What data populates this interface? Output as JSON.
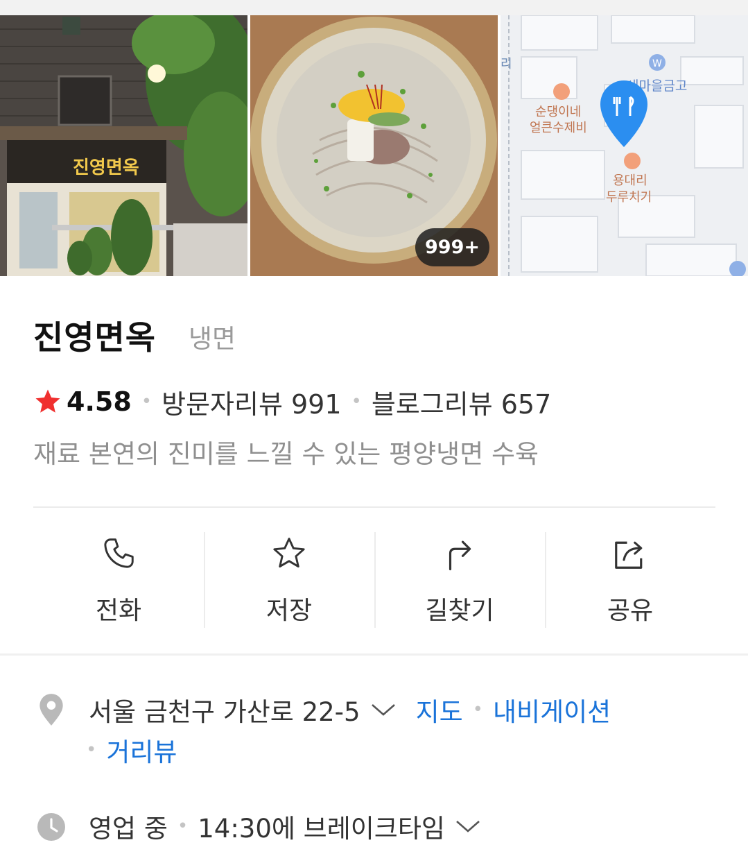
{
  "photos": {
    "storefront_sign": "진영면옥",
    "photo_count_badge": "999+",
    "map_labels": [
      "새마을금고",
      "순댕이네 얼큰수제비",
      "용대리 두루치기",
      "리"
    ]
  },
  "place": {
    "name": "진영면옥",
    "category": "냉면",
    "rating": "4.58",
    "visitor_review_label": "방문자리뷰 991",
    "blog_review_label": "블로그리뷰 657",
    "description": "재료 본연의 진미를 느낄 수 있는 평양냉면 수육"
  },
  "actions": [
    {
      "label": "전화",
      "icon": "phone-icon"
    },
    {
      "label": "저장",
      "icon": "star-outline-icon"
    },
    {
      "label": "길찾기",
      "icon": "directions-icon"
    },
    {
      "label": "공유",
      "icon": "share-icon"
    }
  ],
  "address": {
    "text": "서울 금천구 가산로 22-5",
    "links": [
      "지도",
      "내비게이션",
      "거리뷰"
    ]
  },
  "hours": {
    "status": "영업 중",
    "detail": "14:30에 브레이크타임"
  },
  "colors": {
    "accent_link": "#1a73d9",
    "star": "#f0302f",
    "map_pin": "#2b8ef0"
  }
}
